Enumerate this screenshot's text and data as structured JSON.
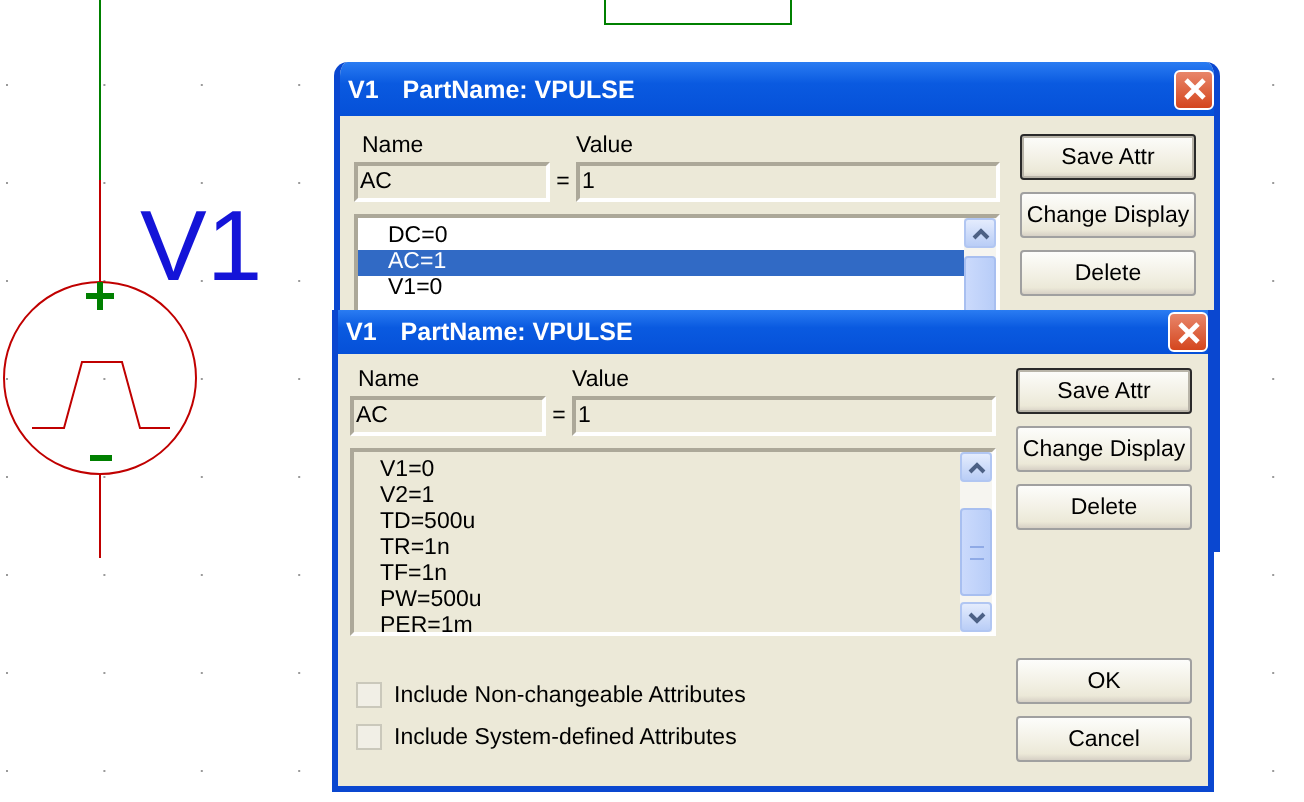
{
  "schematic": {
    "part_label": "V1"
  },
  "dialogs": [
    {
      "ref": "V1",
      "title": "PartName: VPULSE",
      "name_label": "Name",
      "value_label": "Value",
      "name_value": "AC",
      "equals": "=",
      "value": "1",
      "attributes": [
        {
          "text": "DC=0",
          "selected": false
        },
        {
          "text": "AC=1",
          "selected": true
        },
        {
          "text": "V1=0",
          "selected": false
        }
      ],
      "buttons": [
        {
          "label": "Save Attr",
          "default": true
        },
        {
          "label": "Change Display",
          "default": false
        },
        {
          "label": "Delete",
          "default": false
        }
      ]
    },
    {
      "ref": "V1",
      "title": "PartName: VPULSE",
      "name_label": "Name",
      "value_label": "Value",
      "name_value": "AC",
      "equals": "=",
      "value": "1",
      "attributes": [
        {
          "text": "V1=0",
          "selected": false
        },
        {
          "text": "V2=1",
          "selected": false
        },
        {
          "text": "TD=500u",
          "selected": false
        },
        {
          "text": "TR=1n",
          "selected": false
        },
        {
          "text": "TF=1n",
          "selected": false
        },
        {
          "text": "PW=500u",
          "selected": false
        },
        {
          "text": "PER=1m",
          "selected": false
        }
      ],
      "buttons": [
        {
          "label": "Save Attr",
          "default": true
        },
        {
          "label": "Change Display",
          "default": false
        },
        {
          "label": "Delete",
          "default": false
        }
      ],
      "checkboxes": [
        {
          "label": "Include Non-changeable Attributes",
          "checked": false
        },
        {
          "label": "Include System-defined Attributes",
          "checked": false
        }
      ],
      "footer_buttons": [
        {
          "label": "OK",
          "default": false
        },
        {
          "label": "Cancel",
          "default": false
        }
      ]
    }
  ]
}
